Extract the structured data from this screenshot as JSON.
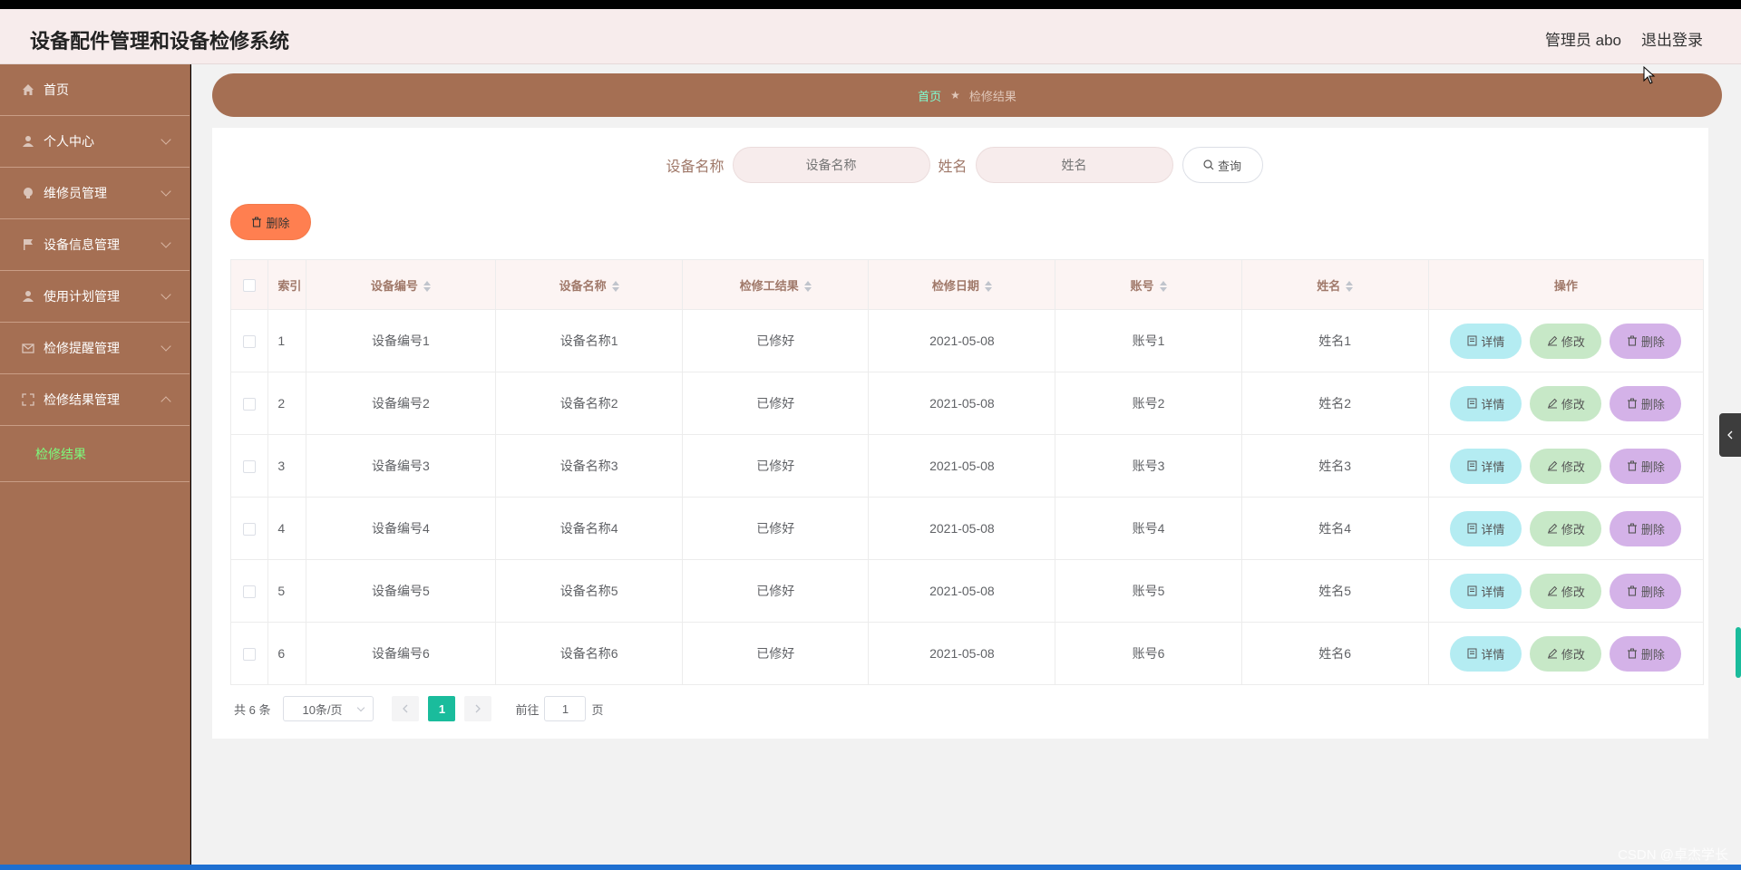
{
  "app": {
    "title": "设备配件管理和设备检修系统",
    "user_label": "管理员 abo",
    "logout_label": "退出登录"
  },
  "sidebar": {
    "items": [
      {
        "label": "首页",
        "icon": "home-icon"
      },
      {
        "label": "个人中心",
        "icon": "user-icon"
      },
      {
        "label": "维修员管理",
        "icon": "bulb-icon"
      },
      {
        "label": "设备信息管理",
        "icon": "flag-icon"
      },
      {
        "label": "使用计划管理",
        "icon": "user-icon"
      },
      {
        "label": "检修提醒管理",
        "icon": "message-icon"
      },
      {
        "label": "检修结果管理",
        "icon": "fullscreen-icon"
      }
    ],
    "active_sub": "检修结果"
  },
  "breadcrumb": {
    "home": "首页",
    "separator": "★",
    "current": "检修结果"
  },
  "search": {
    "field1_label": "设备名称",
    "field1_placeholder": "设备名称",
    "field2_label": "姓名",
    "field2_placeholder": "姓名",
    "button_label": "查询"
  },
  "toolbar": {
    "delete_label": "删除"
  },
  "table": {
    "headers": [
      "索引",
      "设备编号",
      "设备名称",
      "检修工结果",
      "检修日期",
      "账号",
      "姓名",
      "操作"
    ],
    "rows": [
      {
        "index": "1",
        "code": "设备编号1",
        "name": "设备名称1",
        "result": "已修好",
        "date": "2021-05-08",
        "account": "账号1",
        "person": "姓名1"
      },
      {
        "index": "2",
        "code": "设备编号2",
        "name": "设备名称2",
        "result": "已修好",
        "date": "2021-05-08",
        "account": "账号2",
        "person": "姓名2"
      },
      {
        "index": "3",
        "code": "设备编号3",
        "name": "设备名称3",
        "result": "已修好",
        "date": "2021-05-08",
        "account": "账号3",
        "person": "姓名3"
      },
      {
        "index": "4",
        "code": "设备编号4",
        "name": "设备名称4",
        "result": "已修好",
        "date": "2021-05-08",
        "account": "账号4",
        "person": "姓名4"
      },
      {
        "index": "5",
        "code": "设备编号5",
        "name": "设备名称5",
        "result": "已修好",
        "date": "2021-05-08",
        "account": "账号5",
        "person": "姓名5"
      },
      {
        "index": "6",
        "code": "设备编号6",
        "name": "设备名称6",
        "result": "已修好",
        "date": "2021-05-08",
        "account": "账号6",
        "person": "姓名6"
      }
    ],
    "actions": {
      "detail": "详情",
      "edit": "修改",
      "remove": "删除"
    }
  },
  "pagination": {
    "total": "共 6 条",
    "page_size": "10条/页",
    "current_page": "1",
    "goto_prefix": "前往",
    "goto_value": "1",
    "goto_suffix": "页"
  },
  "watermark": "CSDN @卓杰学长",
  "colors": {
    "sidebar": "#a56f53",
    "header": "#f7ecec",
    "accent": "#1abc9c",
    "delete_button": "#ff7f50",
    "detail_button": "#b4ecf2",
    "edit_button": "#c7e8c7",
    "remove_button": "#d4b2e8"
  }
}
